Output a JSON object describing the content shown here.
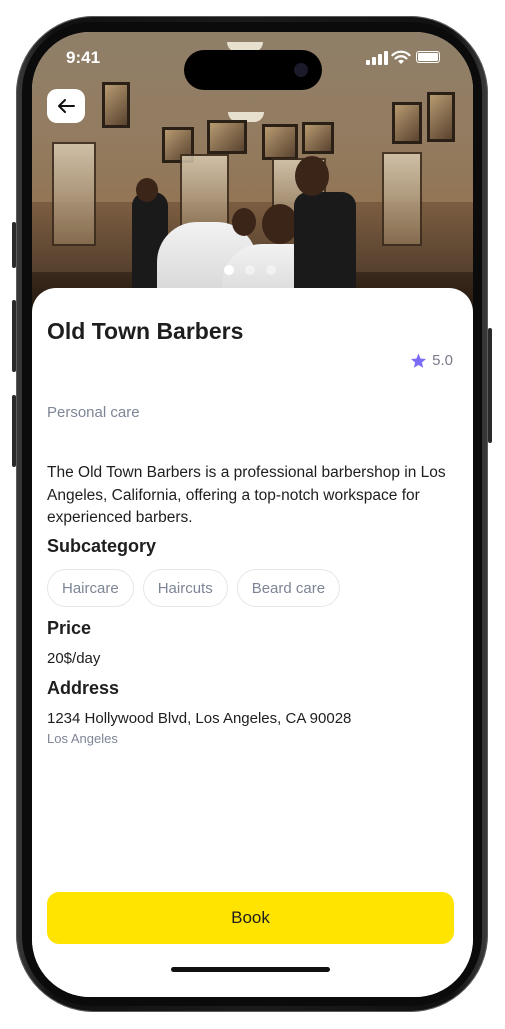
{
  "status_bar": {
    "time": "9:41"
  },
  "hero": {
    "image_alt": "Barbershop interior photo",
    "carousel_total": 3,
    "carousel_active": 1
  },
  "place": {
    "name": "Old Town Barbers",
    "rating": "5.0",
    "category": "Personal care",
    "description": "The Old Town Barbers is a professional barbershop in Los Angeles, California, offering a top-notch workspace for experienced barbers."
  },
  "sections": {
    "subcategory_title": "Subcategory",
    "subcategories": [
      "Haircare",
      "Haircuts",
      "Beard care"
    ],
    "price_title": "Price",
    "price_value": "20$/day",
    "address_title": "Address",
    "address_line": "1234 Hollywood Blvd, Los Angeles, CA 90028",
    "address_city": "Los Angeles"
  },
  "actions": {
    "book_label": "Book"
  },
  "colors": {
    "accent_yellow": "#ffe400",
    "star": "#7b6cf6",
    "muted": "#7d8595"
  },
  "icons": {
    "back": "arrow-left-icon",
    "rating": "star-icon",
    "signal": "cellular-signal-icon",
    "wifi": "wifi-icon",
    "battery": "battery-icon"
  }
}
